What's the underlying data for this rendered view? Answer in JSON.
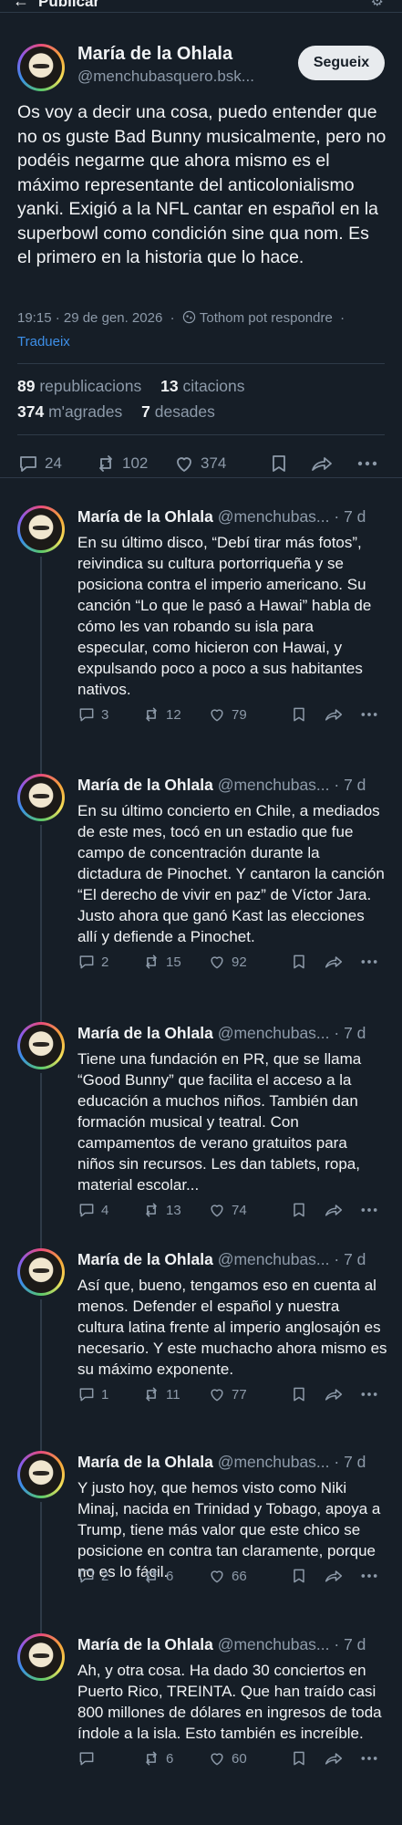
{
  "header": {
    "title": "Publicar",
    "back_icon": "arrow-left-icon",
    "settings_icon": "gear-icon"
  },
  "main_post": {
    "author_name": "María de la Ohlala",
    "author_handle": "@menchubasquero.bsk...",
    "follow_label": "Segueix",
    "text": "Os voy a decir una cosa, puedo entender que no os guste Bad Bunny musicalmente, pero no podéis negarme que ahora mismo es el máximo representante del anticolonialismo yanki. Exigió a la NFL cantar en español en la superbowl como condición sine qua nom. Es el primero en la historia que lo hace.",
    "timestamp": "19:15 · 29 de gen. 2026",
    "reply_setting": "Tothom pot respondre",
    "translate_label": "Tradueix",
    "reposts_count": "89",
    "reposts_label": "republicacions",
    "quotes_count": "13",
    "quotes_label": "citacions",
    "likes_count": "374",
    "likes_label": "m'agrades",
    "saves_count": "7",
    "saves_label": "desades",
    "actions": {
      "replies": "24",
      "reposts": "102",
      "likes": "374"
    }
  },
  "replies": [
    {
      "name": "María de la Ohlala",
      "handle": "@menchubas...",
      "time": "· 7 d",
      "text": "En su último disco, “Debí tirar más fotos”, reivindica su cultura portorriqueña y se posiciona contra el imperio americano. Su canción “Lo que le pasó a Hawai” habla de cómo les van robando su isla para especular, como hicieron con Hawai, y expulsando poco a poco a sus habitantes nativos.",
      "replies": "3",
      "reposts": "12",
      "likes": "79"
    },
    {
      "name": "María de la Ohlala",
      "handle": "@menchubas...",
      "time": "· 7 d",
      "text": "En su último concierto en Chile, a mediados de este mes, tocó en un estadio que fue campo de concentración durante la dictadura de Pinochet. Y cantaron la canción “El derecho de vivir en paz” de Víctor Jara. Justo ahora que ganó Kast las elecciones allí y defiende a Pinochet.",
      "replies": "2",
      "reposts": "15",
      "likes": "92"
    },
    {
      "name": "María de la Ohlala",
      "handle": "@menchubas...",
      "time": "· 7 d",
      "text": "Tiene una fundación en PR, que se llama “Good Bunny” que facilita el acceso a la  educación a muchos niños. También dan formación musical y teatral. Con campamentos de verano gratuitos para niños sin recursos. Les dan tablets, ropa, material escolar...",
      "replies": "4",
      "reposts": "13",
      "likes": "74"
    },
    {
      "name": "María de la Ohlala",
      "handle": "@menchubas...",
      "time": "· 7 d",
      "text": "Así que, bueno, tengamos eso en cuenta al menos. Defender el español y nuestra cultura latina frente al imperio anglosajón es necesario. Y este muchacho ahora mismo es su máximo exponente.",
      "replies": "1",
      "reposts": "11",
      "likes": "77"
    },
    {
      "name": "María de la Ohlala",
      "handle": "@menchubas...",
      "time": "· 7 d",
      "text": "Y justo hoy, que hemos visto como Niki Minaj, nacida en Trinidad y Tobago, apoya a Trump, tiene más valor que este chico se posicione en contra tan claramente, porque no es lo fácil.",
      "replies": "2",
      "reposts": "6",
      "likes": "66"
    },
    {
      "name": "María de la Ohlala",
      "handle": "@menchubas...",
      "time": "· 7 d",
      "text": "Ah, y otra cosa. Ha dado 30 conciertos en Puerto Rico, TREINTA. Que han traído casi 800 millones de dólares en ingresos de toda índole a la isla. Esto también es increíble.",
      "replies": "",
      "reposts": "6",
      "likes": "60"
    }
  ],
  "colors": {
    "background": "#161e27",
    "text": "#f1f3f5",
    "muted": "#8d9aa9",
    "link": "#3d8fe8",
    "divider": "#2e3a48"
  }
}
